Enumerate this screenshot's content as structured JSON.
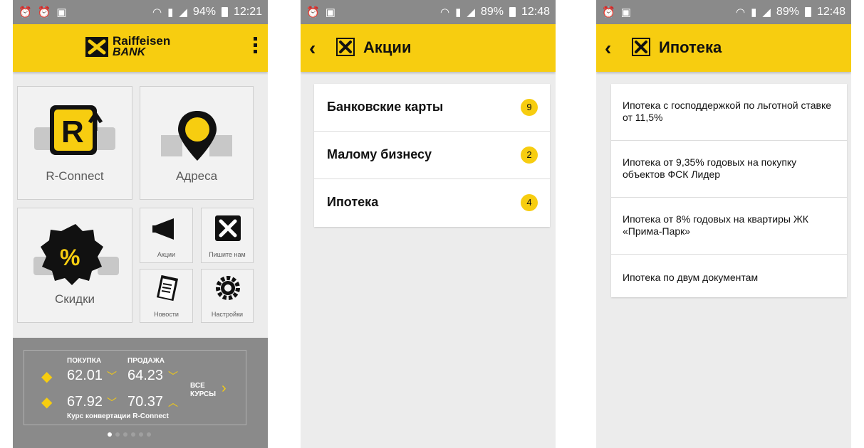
{
  "screens": [
    {
      "status": {
        "percent": "94%",
        "time": "12:21"
      },
      "brand": {
        "line1": "Raiffeisen",
        "line2": "BANK"
      },
      "tiles": {
        "rconnect": "R-Connect",
        "addresses": "Адреса",
        "discounts": "Скидки",
        "promos": "Акции",
        "write_us": "Пишите нам",
        "news": "Новости",
        "settings": "Настройки"
      },
      "rates": {
        "buy_label": "ПОКУПКА",
        "sell_label": "ПРОДАЖА",
        "row1_buy": "62.01",
        "row1_sell": "64.23",
        "row2_buy": "67.92",
        "row2_sell": "70.37",
        "all_rates_line1": "ВСЕ",
        "all_rates_line2": "КУРСЫ",
        "caption": "Курс конвертации R-Connect"
      },
      "icons": [
        "alarm-icon",
        "bag-icon",
        "wifi-icon",
        "sim-icon",
        "signal-icon",
        "battery-icon",
        "kebab-menu-icon",
        "megaphone-icon",
        "news-icon",
        "gear-icon",
        "map-pin-icon",
        "percent-icon",
        "tag-icon",
        "chevron-down-icon",
        "chevron-up-icon",
        "chevron-right-icon"
      ]
    },
    {
      "status": {
        "percent": "89%",
        "time": "12:48"
      },
      "title": "Акции",
      "items": [
        {
          "label": "Банковские карты",
          "count": "9"
        },
        {
          "label": "Малому бизнесу",
          "count": "2"
        },
        {
          "label": "Ипотека",
          "count": "4"
        }
      ]
    },
    {
      "status": {
        "percent": "89%",
        "time": "12:48"
      },
      "title": "Ипотека",
      "items": [
        {
          "label": "Ипотека с господдержкой по льготной ставке от 11,5%"
        },
        {
          "label": "Ипотека от 9,35% годовых на покупку объектов ФСК Лидер"
        },
        {
          "label": "Ипотека от 8% годовых на квартиры ЖК «Прима-Парк»"
        },
        {
          "label": "Ипотека по двум документам"
        }
      ]
    }
  ],
  "colors": {
    "accent": "#f7cd10",
    "statusbar": "#8a8a8a",
    "background": "#ececec"
  }
}
